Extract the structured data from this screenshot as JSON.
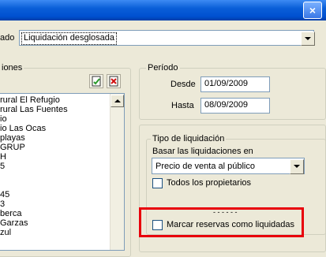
{
  "window": {
    "close_label": "×"
  },
  "top": {
    "field_label": "ado",
    "combo_value": "Liquidación desglosada"
  },
  "left": {
    "legend": "iones",
    "list_items": [
      "rural El Refugio",
      "rural Las Fuentes",
      "io",
      "io Las Ocas",
      "playas",
      "GRUP",
      "H",
      "5",
      "",
      "",
      "45",
      "3",
      "berca",
      "Garzas",
      "zul"
    ]
  },
  "periodo": {
    "legend": "Período",
    "desde_label": "Desde",
    "desde_value": "01/09/2009",
    "hasta_label": "Hasta",
    "hasta_value": "08/09/2009"
  },
  "tipo": {
    "legend": "Tipo de liquidación",
    "basar_label": "Basar las liquidaciones en",
    "basar_value": "Precio de venta al público",
    "todos_label": "Todos los propietarios",
    "separator": "- - - - - -",
    "marcar_label": "Marcar reservas como liquidadas"
  },
  "colors": {
    "highlight": "#e8000b",
    "title_blue": "#0050d0"
  }
}
